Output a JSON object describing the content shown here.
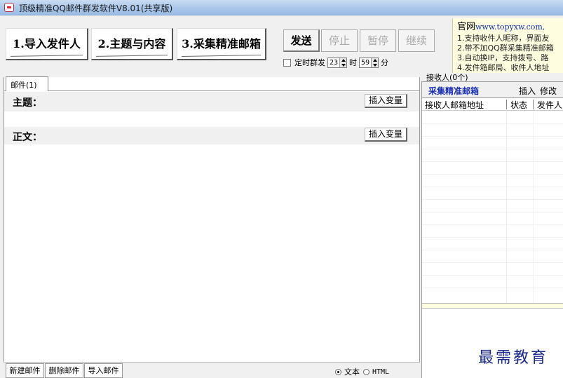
{
  "window": {
    "title": "顶级精准QQ邮件群发软件V8.01(共享版)"
  },
  "steps": {
    "import": "1.导入发件人",
    "content": "2.主题与内容",
    "collect": "3.采集精准邮箱"
  },
  "controls": {
    "send": "发送",
    "stop": "停止",
    "pause": "暂停",
    "resume": "继续"
  },
  "timer": {
    "label": "定时群发",
    "hour_value": "23",
    "hour_unit": "时",
    "minute_value": "59",
    "minute_unit": "分"
  },
  "info": {
    "site_label": "官网",
    "site_url": "www.topyxw.com,",
    "lines": [
      "1.支持收件人昵称，界面友",
      "2.带不加QQ群采集精准邮箱",
      "3.自动换IP，支持拨号、路",
      "4.发件箱邮局、收件人地址"
    ]
  },
  "mail": {
    "tab_label": "邮件(1)",
    "subject_label": "主题：",
    "body_label": "正文：",
    "insert_var": "插入变量",
    "new_mail": "新建邮件",
    "delete_mail": "删除邮件",
    "import_mail": "导入邮件",
    "format_text": "文本",
    "format_html": "HTML",
    "selected_format": "文本"
  },
  "recipients": {
    "title": "接收人(0个)",
    "collect_link": "采集精准邮箱",
    "insert": "插入",
    "edit": "修改",
    "columns": [
      "接收人邮箱地址",
      "状态",
      "发件人"
    ]
  },
  "watermark": "最需教育"
}
